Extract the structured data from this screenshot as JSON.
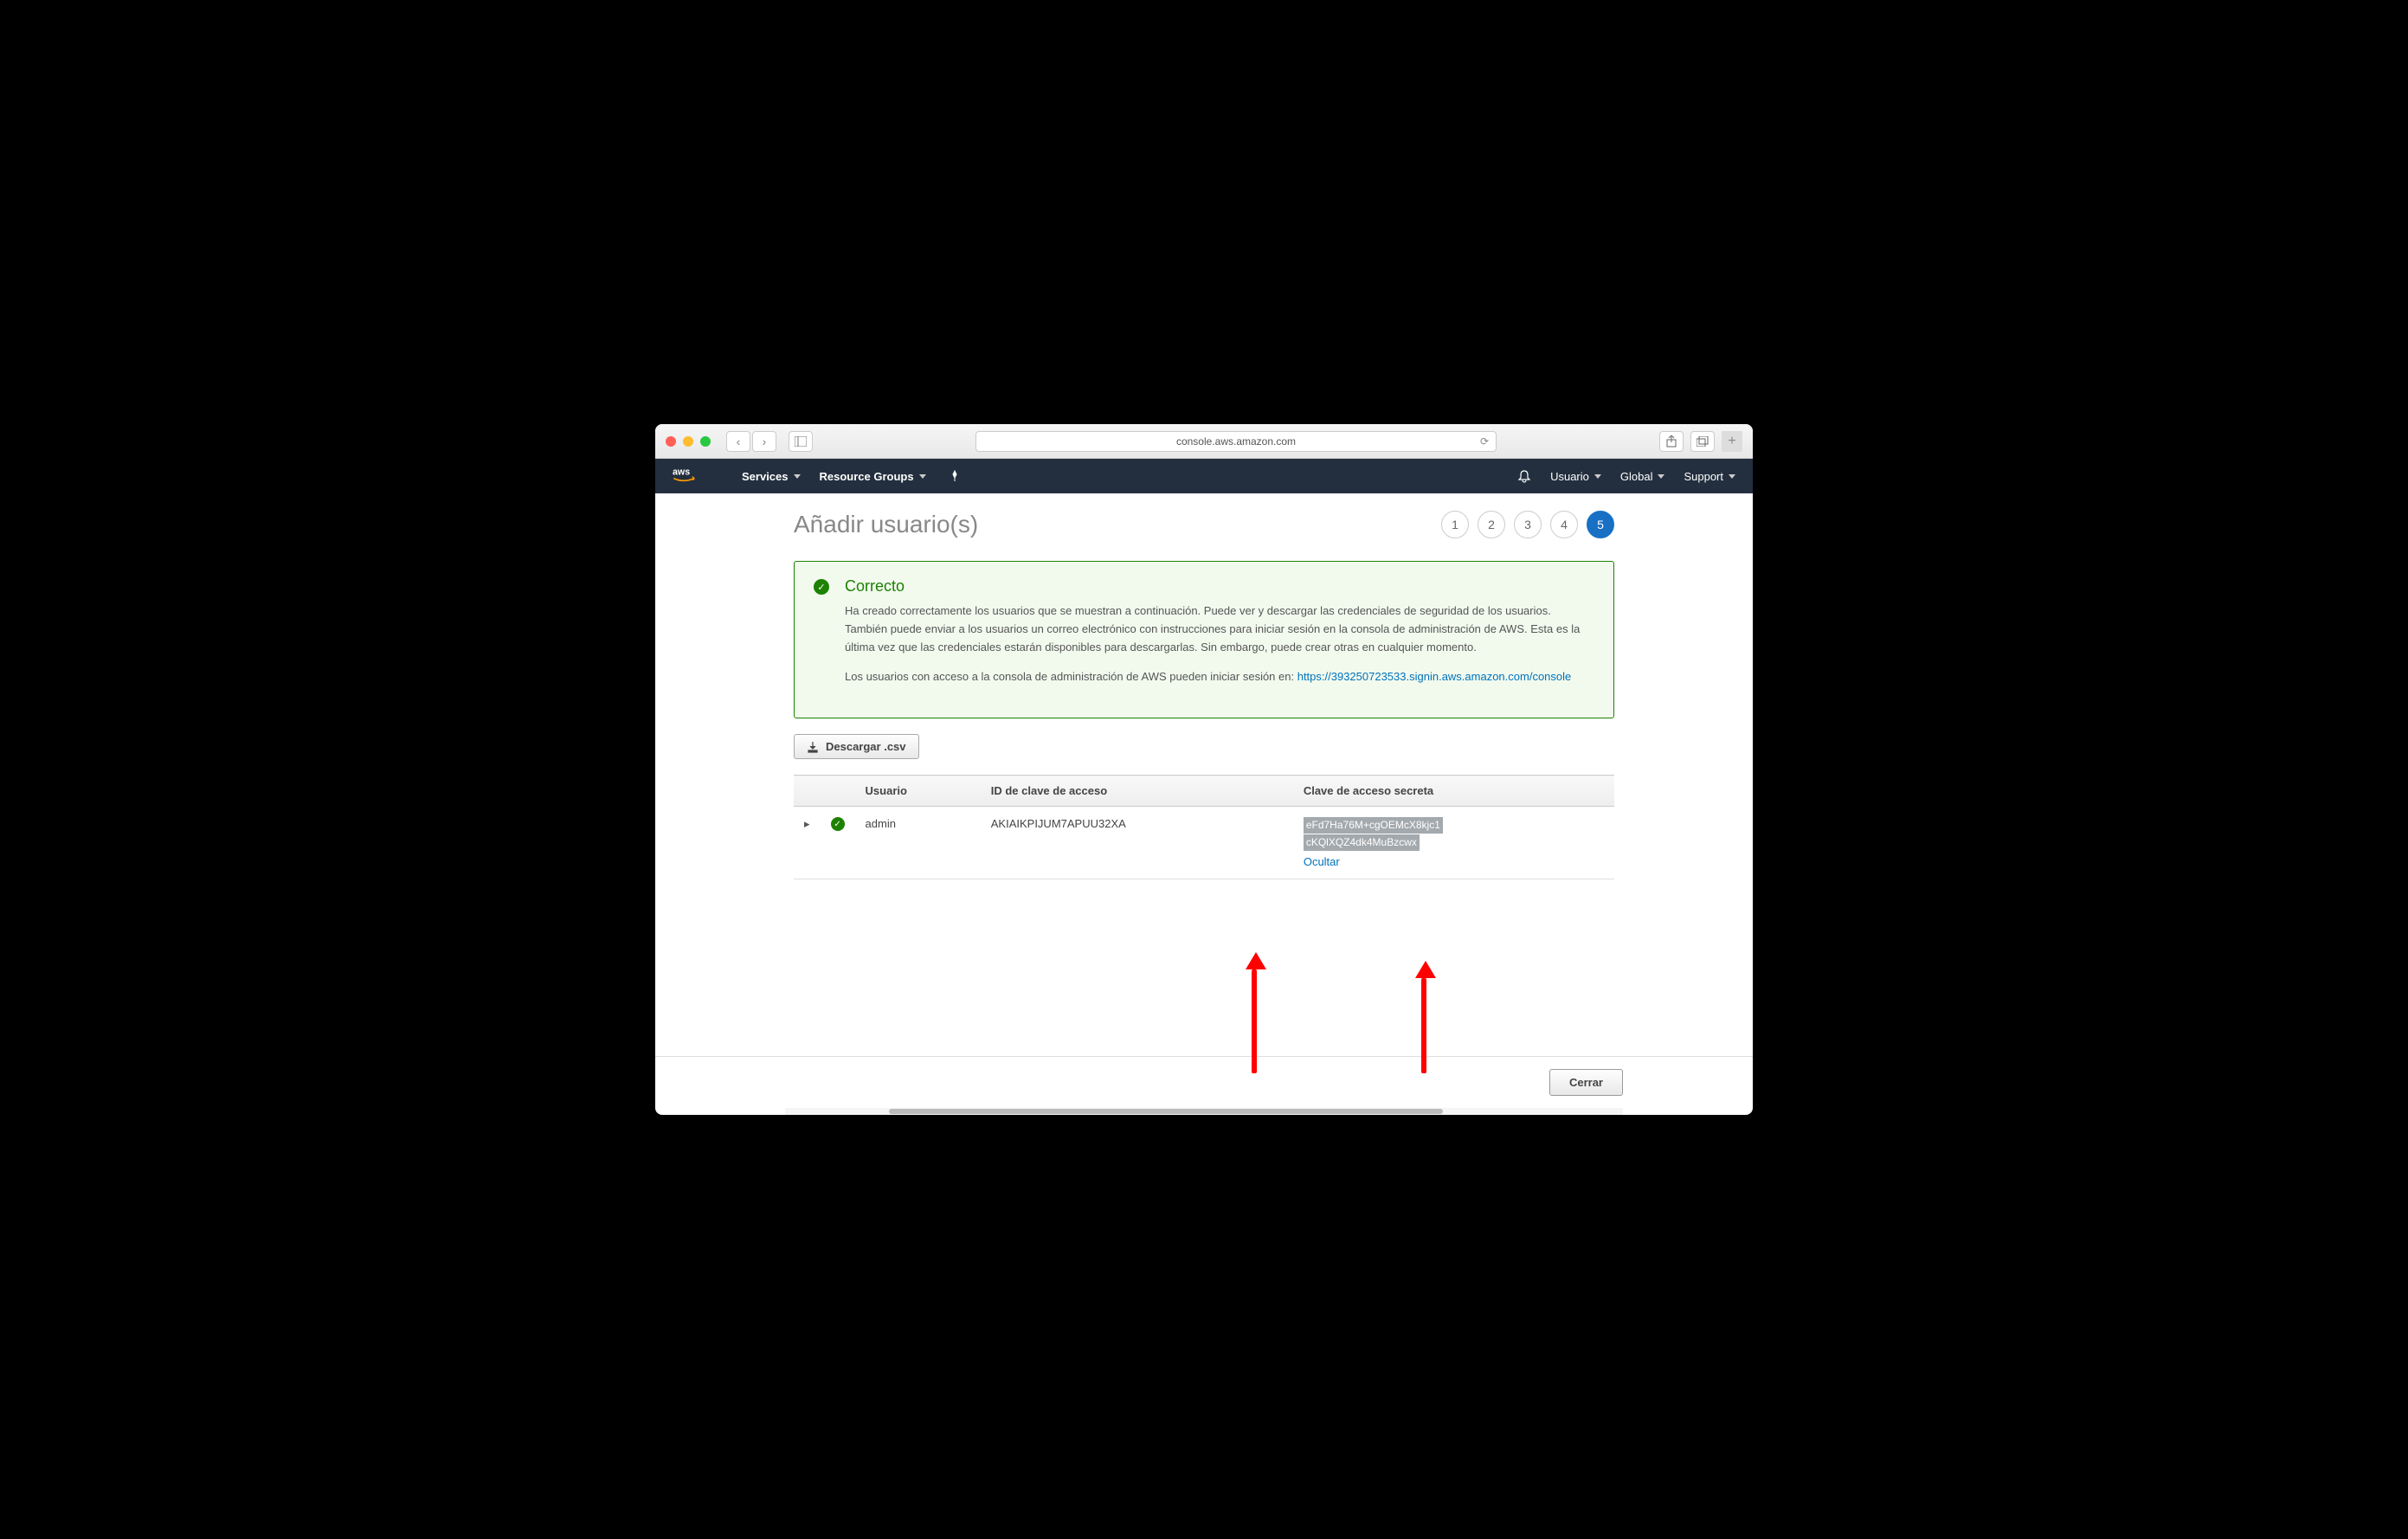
{
  "browser": {
    "url": "console.aws.amazon.com"
  },
  "nav": {
    "services": "Services",
    "resource_groups": "Resource Groups",
    "usuario": "Usuario",
    "global": "Global",
    "support": "Support"
  },
  "page": {
    "title": "Añadir usuario(s)",
    "steps": [
      "1",
      "2",
      "3",
      "4",
      "5"
    ],
    "active_step": 5
  },
  "alert": {
    "title": "Correcto",
    "text1": "Ha creado correctamente los usuarios que se muestran a continuación. Puede ver y descargar las credenciales de seguridad de los usuarios. También puede enviar a los usuarios un correo electrónico con instrucciones para iniciar sesión en la consola de administración de AWS. Esta es la última vez que las credenciales estarán disponibles para descargarlas. Sin embargo, puede crear otras en cualquier momento.",
    "text2": "Los usuarios con acceso a la consola de administración de AWS pueden iniciar sesión en: ",
    "link": "https://393250723533.signin.aws.amazon.com/console"
  },
  "download_label": "Descargar .csv",
  "table": {
    "headers": {
      "user": "Usuario",
      "access_key_id": "ID de clave de acceso",
      "secret_access_key": "Clave de acceso secreta"
    },
    "row": {
      "user": "admin",
      "access_key_id": "AKIAIKPIJUM7APUU32XA",
      "secret_line1": "eFd7Ha76M+cgOEMcX8kjc1",
      "secret_line2": "cKQlXQZ4dk4MuBzcwx",
      "hide_label": "Ocultar"
    }
  },
  "footer": {
    "close": "Cerrar"
  }
}
